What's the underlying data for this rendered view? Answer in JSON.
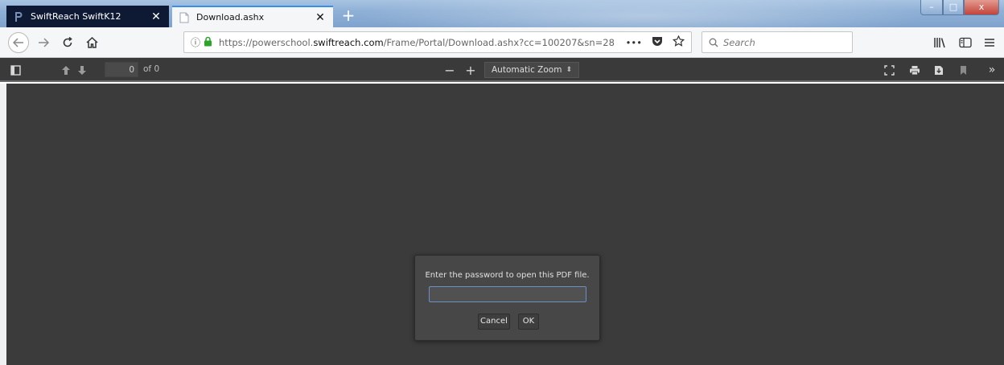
{
  "browser": {
    "tabs": [
      {
        "title": "SwiftReach SwiftK12",
        "favicon": "powerschool-p-icon",
        "active": false
      },
      {
        "title": "Download.ashx",
        "favicon": "document-icon",
        "active": true
      }
    ],
    "new_tab_label": "+",
    "window_controls": {
      "minimize": "–",
      "maximize": "□",
      "close": "x"
    }
  },
  "navbar": {
    "url_prefix": "https://powerschool.",
    "url_domain": "swiftreach.com",
    "url_path": "/Frame/Portal/Download.ashx?cc=100207&sn=28",
    "page_actions_label": "•••",
    "search_placeholder": "Search"
  },
  "pdf_toolbar": {
    "page_number": "0",
    "page_of": "of 0",
    "zoom_out_label": "−",
    "zoom_in_label": "+",
    "zoom_value": "Automatic Zoom",
    "more_tools_label": "»"
  },
  "password_dialog": {
    "prompt": "Enter the password to open this PDF file.",
    "password_value": "",
    "cancel_label": "Cancel",
    "ok_label": "OK"
  },
  "colors": {
    "viewer_background": "#3b3b3b",
    "toolbar_background": "#3a3a3a",
    "active_tab_accent": "#3b8ee8",
    "secure_lock": "#2aa52a",
    "inactive_tab_background": "#0e1a33"
  }
}
